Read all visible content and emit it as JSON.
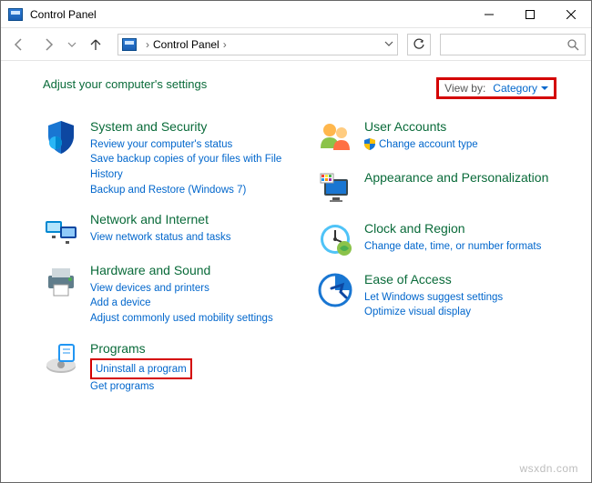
{
  "window": {
    "title": "Control Panel"
  },
  "nav": {
    "breadcrumb": "Control Panel"
  },
  "header": {
    "title": "Adjust your computer's settings",
    "viewby_label": "View by:",
    "viewby_value": "Category"
  },
  "left_col": [
    {
      "title": "System and Security",
      "links": [
        "Review your computer's status",
        "Save backup copies of your files with File History",
        "Backup and Restore (Windows 7)"
      ]
    },
    {
      "title": "Network and Internet",
      "links": [
        "View network status and tasks"
      ]
    },
    {
      "title": "Hardware and Sound",
      "links": [
        "View devices and printers",
        "Add a device",
        "Adjust commonly used mobility settings"
      ]
    },
    {
      "title": "Programs",
      "links": [
        "Uninstall a program",
        "Get programs"
      ],
      "highlight_first": true
    }
  ],
  "right_col": [
    {
      "title": "User Accounts",
      "links": [
        "Change account type"
      ]
    },
    {
      "title": "Appearance and Personalization",
      "links": []
    },
    {
      "title": "Clock and Region",
      "links": [
        "Change date, time, or number formats"
      ]
    },
    {
      "title": "Ease of Access",
      "links": [
        "Let Windows suggest settings",
        "Optimize visual display"
      ]
    }
  ],
  "watermark": "wsxdn.com"
}
